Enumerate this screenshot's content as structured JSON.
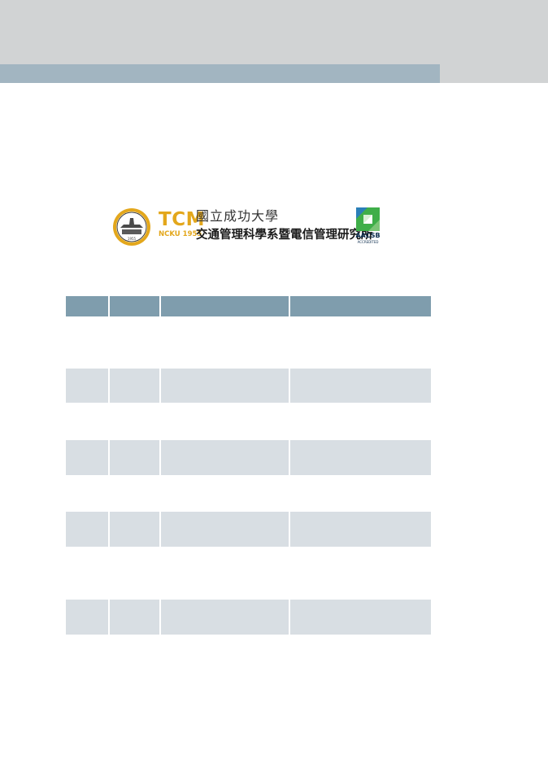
{
  "colors": {
    "top_band": "#d1d3d4",
    "top_stripe": "#a2b5c1",
    "table_header": "#7f9dad",
    "table_row_shaded": "#d8dee3",
    "tcm_gold": "#e3a71c",
    "aacsb_green": "#3fae49",
    "aacsb_navy": "#0b2c4d"
  },
  "logo": {
    "seal_icon": "ncku-seal-icon",
    "tcm": "TCM",
    "ncku_year": "NCKU 1955",
    "university": "國立成功大學",
    "department": "交通管理科學系暨電信管理研究所",
    "aacsb_icon": "aacsb-mark-icon",
    "aacsb": "AACSB",
    "aacsb_sub": "ACCREDITED"
  },
  "table": {
    "column_count": 4,
    "header": [
      "",
      "",
      "",
      ""
    ],
    "rows": [
      [
        "",
        "",
        "",
        ""
      ],
      [
        "",
        "",
        "",
        ""
      ],
      [
        "",
        "",
        "",
        ""
      ],
      [
        "",
        "",
        "",
        ""
      ],
      [
        "",
        "",
        "",
        ""
      ],
      [
        "",
        "",
        "",
        ""
      ],
      [
        "",
        "",
        "",
        ""
      ],
      [
        "",
        "",
        "",
        ""
      ],
      [
        "",
        "",
        "",
        ""
      ]
    ]
  }
}
